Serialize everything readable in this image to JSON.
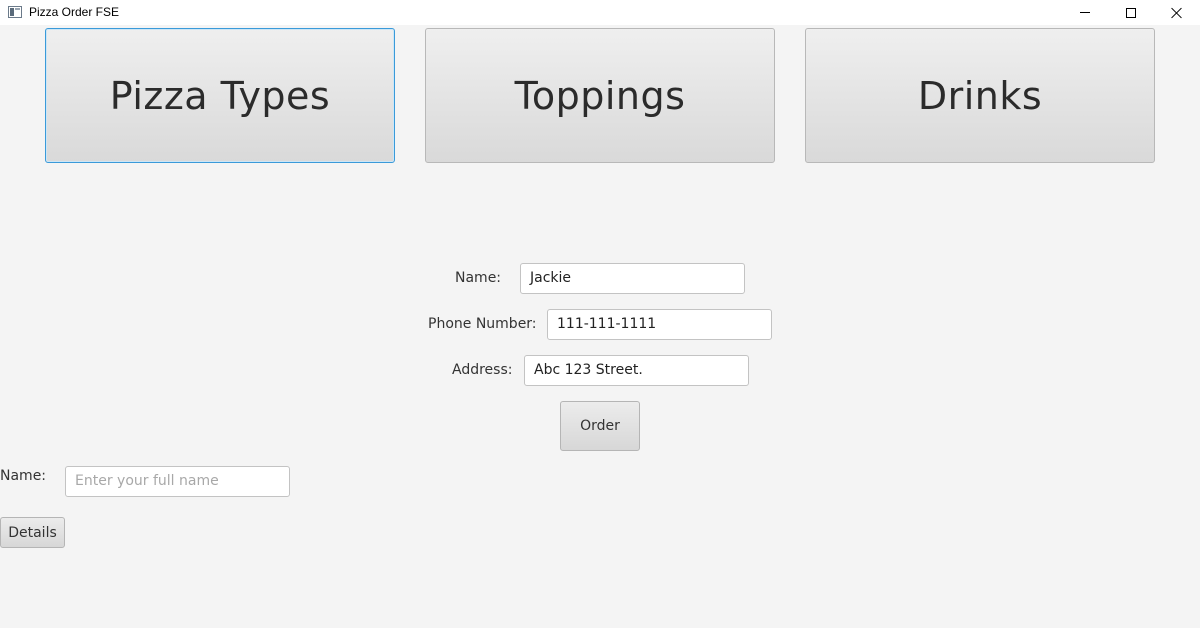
{
  "window": {
    "title": "Pizza Order FSE"
  },
  "top_buttons": {
    "pizza_types": "Pizza Types",
    "toppings": "Toppings",
    "drinks": "Drinks"
  },
  "order_form": {
    "name_label": "Name:",
    "name_value": "Jackie",
    "phone_label": "Phone Number:",
    "phone_value": "111-111-1111",
    "address_label": "Address:",
    "address_value": "Abc 123 Street.",
    "order_button": "Order"
  },
  "lookup_form": {
    "name_label": "Name:",
    "name_placeholder": "Enter your full name",
    "details_button": "Details"
  },
  "icons": {
    "app": "app-window-icon",
    "minimize": "minimize-icon",
    "maximize": "maximize-icon",
    "close": "close-icon"
  },
  "colors": {
    "focus_border": "#3a9ad9",
    "background": "#f4f4f4"
  }
}
